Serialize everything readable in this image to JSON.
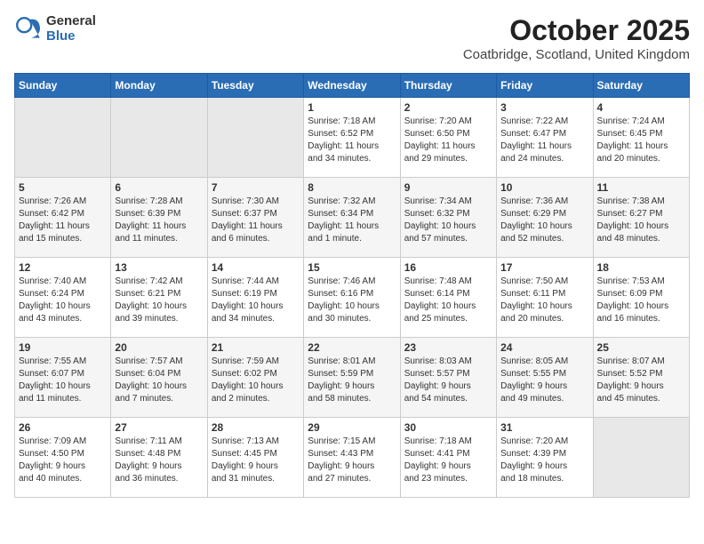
{
  "logo": {
    "general": "General",
    "blue": "Blue"
  },
  "header": {
    "month": "October 2025",
    "location": "Coatbridge, Scotland, United Kingdom"
  },
  "weekdays": [
    "Sunday",
    "Monday",
    "Tuesday",
    "Wednesday",
    "Thursday",
    "Friday",
    "Saturday"
  ],
  "weeks": [
    [
      {
        "day": "",
        "info": ""
      },
      {
        "day": "",
        "info": ""
      },
      {
        "day": "",
        "info": ""
      },
      {
        "day": "1",
        "info": "Sunrise: 7:18 AM\nSunset: 6:52 PM\nDaylight: 11 hours\nand 34 minutes."
      },
      {
        "day": "2",
        "info": "Sunrise: 7:20 AM\nSunset: 6:50 PM\nDaylight: 11 hours\nand 29 minutes."
      },
      {
        "day": "3",
        "info": "Sunrise: 7:22 AM\nSunset: 6:47 PM\nDaylight: 11 hours\nand 24 minutes."
      },
      {
        "day": "4",
        "info": "Sunrise: 7:24 AM\nSunset: 6:45 PM\nDaylight: 11 hours\nand 20 minutes."
      }
    ],
    [
      {
        "day": "5",
        "info": "Sunrise: 7:26 AM\nSunset: 6:42 PM\nDaylight: 11 hours\nand 15 minutes."
      },
      {
        "day": "6",
        "info": "Sunrise: 7:28 AM\nSunset: 6:39 PM\nDaylight: 11 hours\nand 11 minutes."
      },
      {
        "day": "7",
        "info": "Sunrise: 7:30 AM\nSunset: 6:37 PM\nDaylight: 11 hours\nand 6 minutes."
      },
      {
        "day": "8",
        "info": "Sunrise: 7:32 AM\nSunset: 6:34 PM\nDaylight: 11 hours\nand 1 minute."
      },
      {
        "day": "9",
        "info": "Sunrise: 7:34 AM\nSunset: 6:32 PM\nDaylight: 10 hours\nand 57 minutes."
      },
      {
        "day": "10",
        "info": "Sunrise: 7:36 AM\nSunset: 6:29 PM\nDaylight: 10 hours\nand 52 minutes."
      },
      {
        "day": "11",
        "info": "Sunrise: 7:38 AM\nSunset: 6:27 PM\nDaylight: 10 hours\nand 48 minutes."
      }
    ],
    [
      {
        "day": "12",
        "info": "Sunrise: 7:40 AM\nSunset: 6:24 PM\nDaylight: 10 hours\nand 43 minutes."
      },
      {
        "day": "13",
        "info": "Sunrise: 7:42 AM\nSunset: 6:21 PM\nDaylight: 10 hours\nand 39 minutes."
      },
      {
        "day": "14",
        "info": "Sunrise: 7:44 AM\nSunset: 6:19 PM\nDaylight: 10 hours\nand 34 minutes."
      },
      {
        "day": "15",
        "info": "Sunrise: 7:46 AM\nSunset: 6:16 PM\nDaylight: 10 hours\nand 30 minutes."
      },
      {
        "day": "16",
        "info": "Sunrise: 7:48 AM\nSunset: 6:14 PM\nDaylight: 10 hours\nand 25 minutes."
      },
      {
        "day": "17",
        "info": "Sunrise: 7:50 AM\nSunset: 6:11 PM\nDaylight: 10 hours\nand 20 minutes."
      },
      {
        "day": "18",
        "info": "Sunrise: 7:53 AM\nSunset: 6:09 PM\nDaylight: 10 hours\nand 16 minutes."
      }
    ],
    [
      {
        "day": "19",
        "info": "Sunrise: 7:55 AM\nSunset: 6:07 PM\nDaylight: 10 hours\nand 11 minutes."
      },
      {
        "day": "20",
        "info": "Sunrise: 7:57 AM\nSunset: 6:04 PM\nDaylight: 10 hours\nand 7 minutes."
      },
      {
        "day": "21",
        "info": "Sunrise: 7:59 AM\nSunset: 6:02 PM\nDaylight: 10 hours\nand 2 minutes."
      },
      {
        "day": "22",
        "info": "Sunrise: 8:01 AM\nSunset: 5:59 PM\nDaylight: 9 hours\nand 58 minutes."
      },
      {
        "day": "23",
        "info": "Sunrise: 8:03 AM\nSunset: 5:57 PM\nDaylight: 9 hours\nand 54 minutes."
      },
      {
        "day": "24",
        "info": "Sunrise: 8:05 AM\nSunset: 5:55 PM\nDaylight: 9 hours\nand 49 minutes."
      },
      {
        "day": "25",
        "info": "Sunrise: 8:07 AM\nSunset: 5:52 PM\nDaylight: 9 hours\nand 45 minutes."
      }
    ],
    [
      {
        "day": "26",
        "info": "Sunrise: 7:09 AM\nSunset: 4:50 PM\nDaylight: 9 hours\nand 40 minutes."
      },
      {
        "day": "27",
        "info": "Sunrise: 7:11 AM\nSunset: 4:48 PM\nDaylight: 9 hours\nand 36 minutes."
      },
      {
        "day": "28",
        "info": "Sunrise: 7:13 AM\nSunset: 4:45 PM\nDaylight: 9 hours\nand 31 minutes."
      },
      {
        "day": "29",
        "info": "Sunrise: 7:15 AM\nSunset: 4:43 PM\nDaylight: 9 hours\nand 27 minutes."
      },
      {
        "day": "30",
        "info": "Sunrise: 7:18 AM\nSunset: 4:41 PM\nDaylight: 9 hours\nand 23 minutes."
      },
      {
        "day": "31",
        "info": "Sunrise: 7:20 AM\nSunset: 4:39 PM\nDaylight: 9 hours\nand 18 minutes."
      },
      {
        "day": "",
        "info": ""
      }
    ]
  ]
}
